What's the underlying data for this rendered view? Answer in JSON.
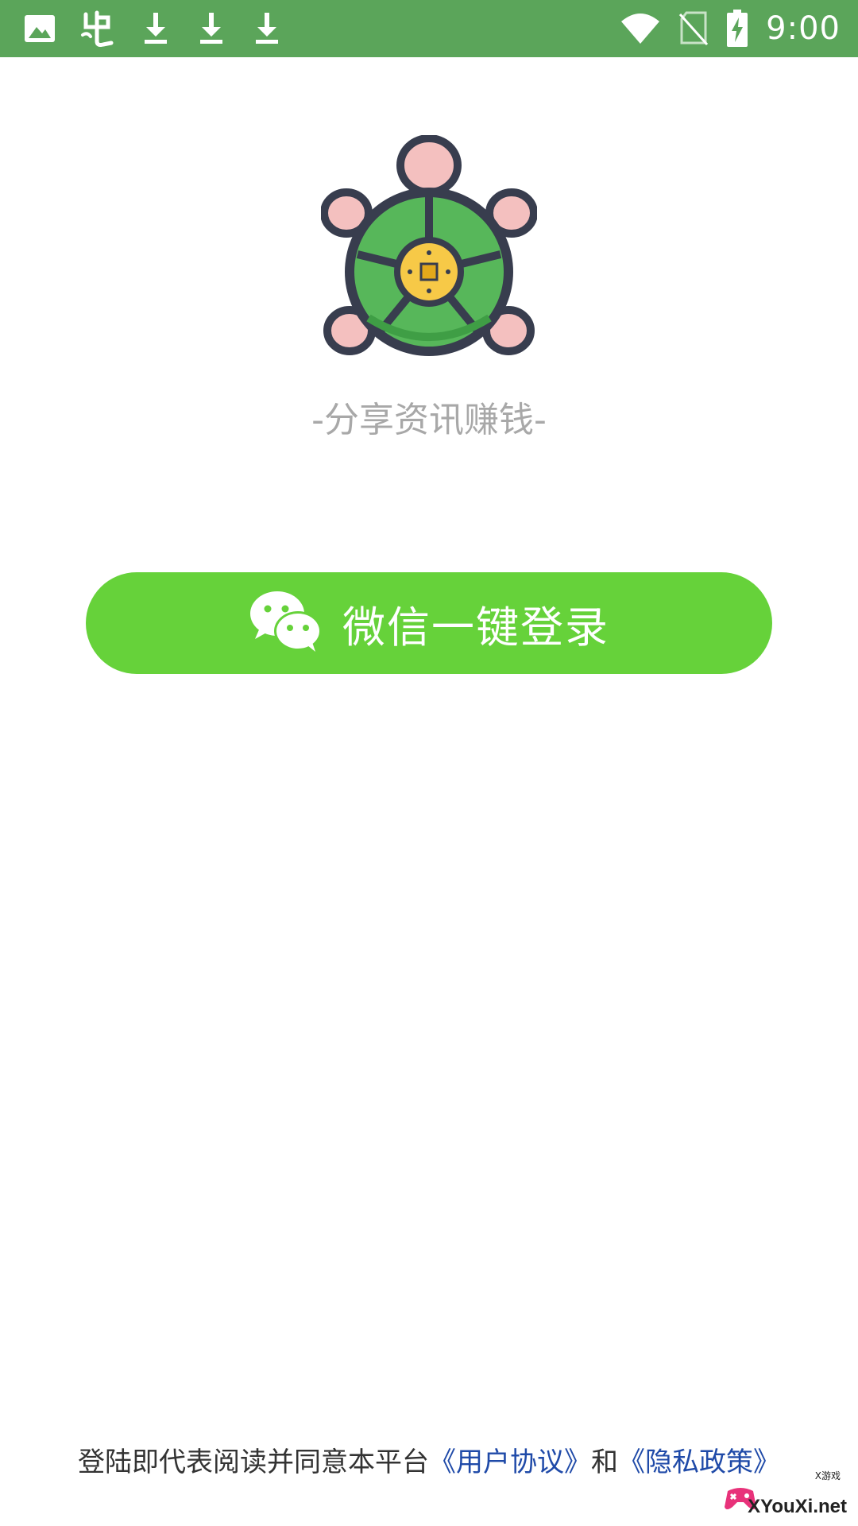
{
  "status_bar": {
    "time": "9:00",
    "left_icons": [
      "image-icon",
      "app-icon",
      "download-icon",
      "download-icon",
      "download-icon"
    ],
    "right_icons": [
      "wifi-icon",
      "no-sim-icon",
      "battery-charging-icon"
    ]
  },
  "brand": {
    "logo": "turtle-coin-logo",
    "slogan": "-分享资讯赚钱-"
  },
  "login": {
    "wechat_label": "微信一键登录",
    "icon": "wechat-icon",
    "color": "#66d23a"
  },
  "agreement": {
    "prefix": "登陆即代表阅读并同意本平台",
    "user_agreement": "《用户协议》",
    "and": "和",
    "privacy_policy": "《隐私政策》"
  },
  "watermark": {
    "small": "X游戏",
    "main": "XYouXi.net"
  },
  "colors": {
    "status_bar": "#5ba55a",
    "link": "#1f4aa8",
    "slogan": "#a8a8a8"
  }
}
